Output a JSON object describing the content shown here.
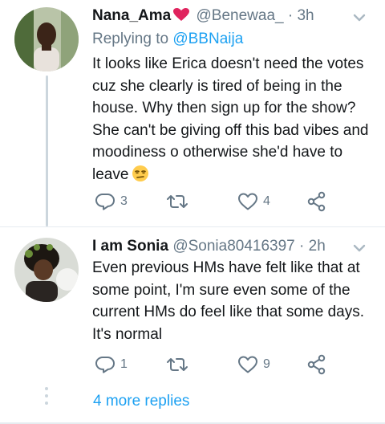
{
  "tweets": [
    {
      "name": "Nana_Ama",
      "name_emoji": "heart-emoji",
      "handle": "@Benewaa_",
      "separator": "·",
      "time": "3h",
      "replying_prefix": "Replying to",
      "replying_to": "@BBNaija",
      "text": "It looks like Erica doesn't need the votes cuz she clearly is tired of being in the house. Why then sign up for the show? She can't be giving off this bad vibes and moodiness o otherwise she'd have to leave",
      "text_emoji": "unamused-face-emoji",
      "reply_count": "3",
      "retweet_count": "",
      "like_count": "4"
    },
    {
      "name": "I am Sonia",
      "handle": "@Sonia80416397",
      "separator": "·",
      "time": "2h",
      "text": "Even previous HMs have felt like that at some point, I'm sure even some of the current HMs do feel like that some days. It's normal",
      "reply_count": "1",
      "retweet_count": "",
      "like_count": "9"
    }
  ],
  "more_replies": "4 more replies",
  "colors": {
    "accent": "#1da1f2",
    "secondary_text": "#657786",
    "heart": "#e0245e",
    "thread_line": "#ccd6dd"
  },
  "icons": [
    "reply-icon",
    "retweet-icon",
    "like-icon",
    "share-icon",
    "caret-down-icon"
  ]
}
